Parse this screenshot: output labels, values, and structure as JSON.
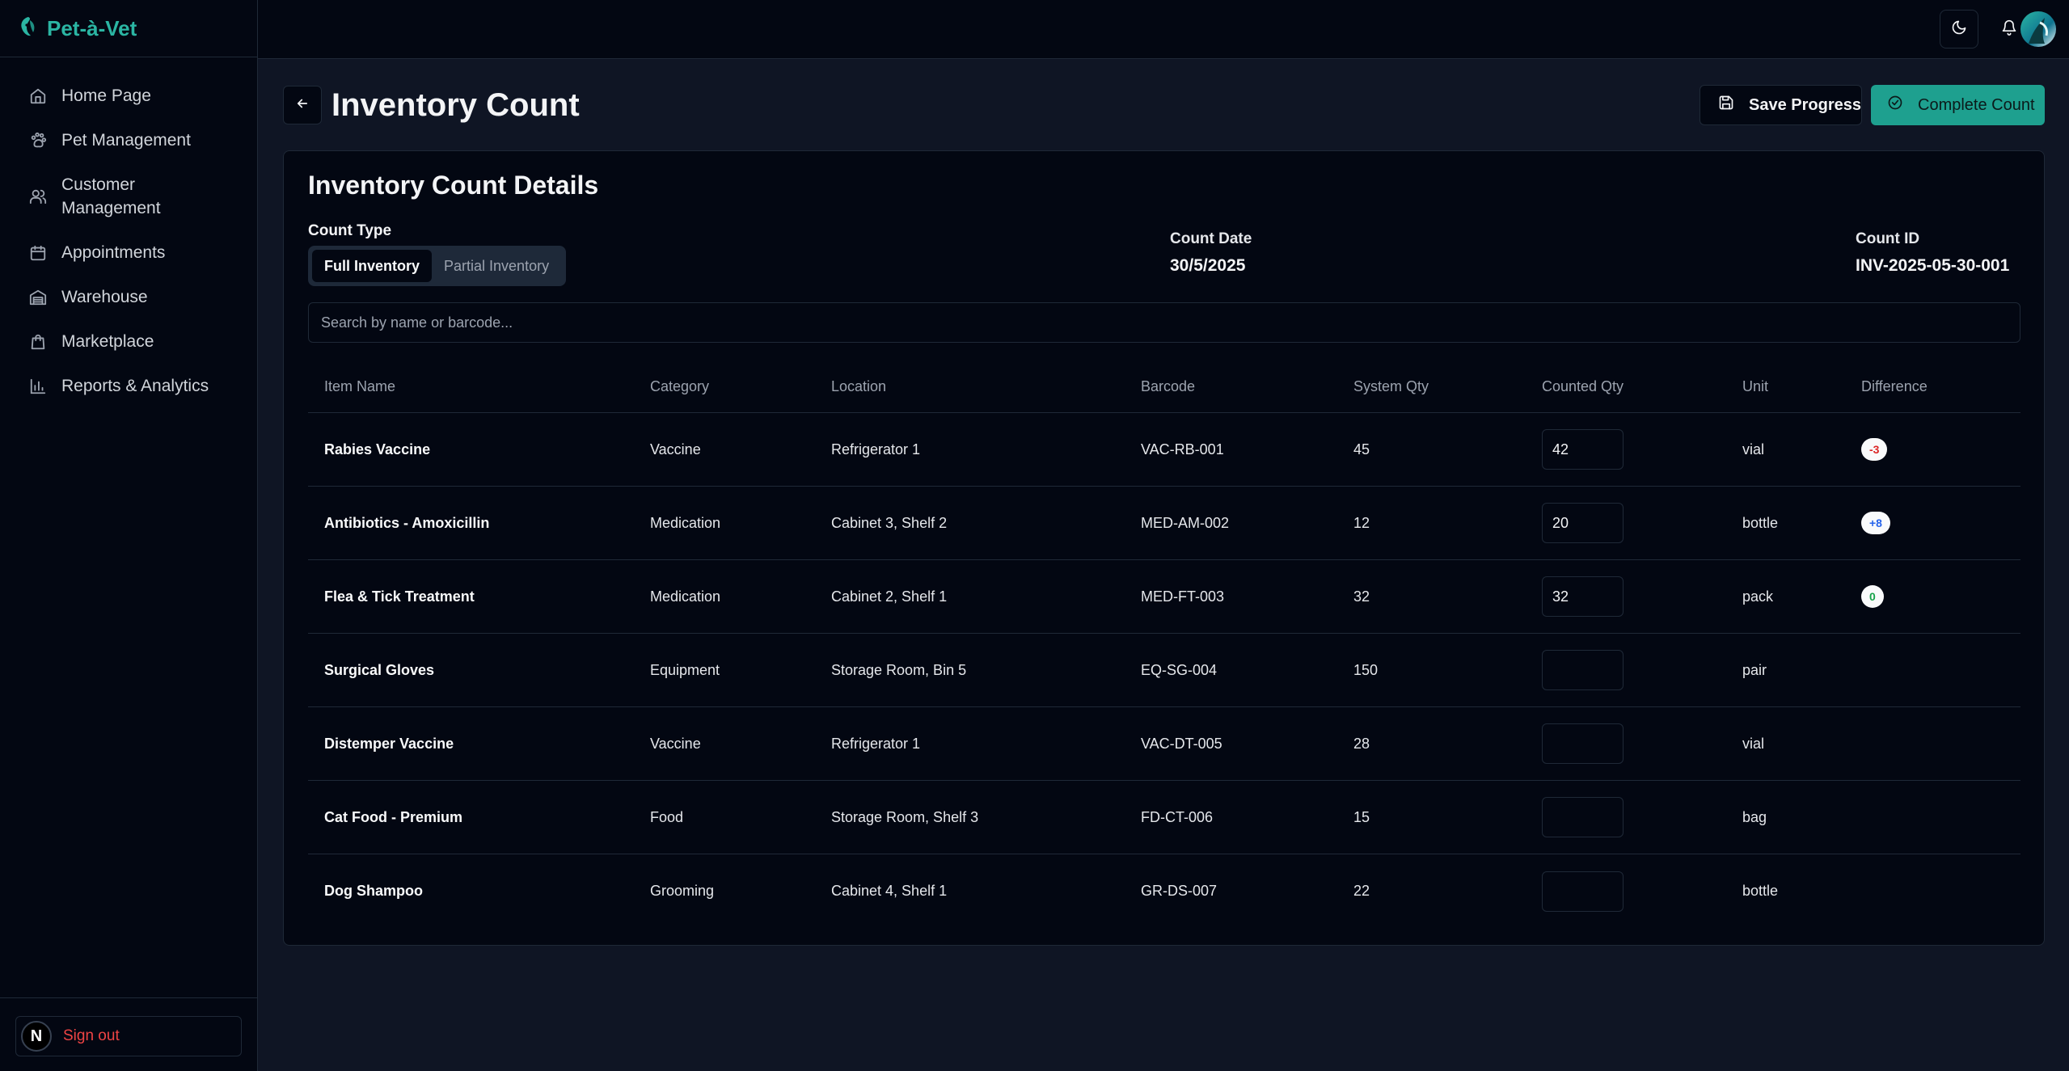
{
  "app": {
    "name": "Pet-à-Vet"
  },
  "sidebar": {
    "items": [
      {
        "label": "Home Page",
        "icon": "home-icon"
      },
      {
        "label": "Pet Management",
        "icon": "paw-icon"
      },
      {
        "label": "Customer Management",
        "icon": "users-icon"
      },
      {
        "label": "Appointments",
        "icon": "calendar-icon"
      },
      {
        "label": "Warehouse",
        "icon": "warehouse-icon"
      },
      {
        "label": "Marketplace",
        "icon": "shopping-bag-icon"
      },
      {
        "label": "Reports & Analytics",
        "icon": "bar-chart-icon"
      }
    ],
    "sign_out": "Sign out",
    "avatar_letter": "N"
  },
  "header": {
    "title": "Inventory Count",
    "save_label": "Save Progress",
    "complete_label": "Complete Count"
  },
  "details": {
    "title": "Inventory Count Details",
    "count_type_label": "Count Type",
    "count_types": [
      "Full Inventory",
      "Partial Inventory"
    ],
    "selected_count_type": "Full Inventory",
    "count_date_label": "Count Date",
    "count_date": "30/5/2025",
    "count_id_label": "Count ID",
    "count_id": "INV-2025-05-30-001",
    "search_placeholder": "Search by name or barcode..."
  },
  "table": {
    "columns": [
      "Item Name",
      "Category",
      "Location",
      "Barcode",
      "System Qty",
      "Counted Qty",
      "Unit",
      "Difference"
    ],
    "rows": [
      {
        "name": "Rabies Vaccine",
        "category": "Vaccine",
        "location": "Refrigerator 1",
        "barcode": "VAC-RB-001",
        "system_qty": "45",
        "counted_qty": "42",
        "unit": "vial",
        "difference": "-3"
      },
      {
        "name": "Antibiotics - Amoxicillin",
        "category": "Medication",
        "location": "Cabinet 3, Shelf 2",
        "barcode": "MED-AM-002",
        "system_qty": "12",
        "counted_qty": "20",
        "unit": "bottle",
        "difference": "+8"
      },
      {
        "name": "Flea & Tick Treatment",
        "category": "Medication",
        "location": "Cabinet 2, Shelf 1",
        "barcode": "MED-FT-003",
        "system_qty": "32",
        "counted_qty": "32",
        "unit": "pack",
        "difference": "0"
      },
      {
        "name": "Surgical Gloves",
        "category": "Equipment",
        "location": "Storage Room, Bin 5",
        "barcode": "EQ-SG-004",
        "system_qty": "150",
        "counted_qty": "",
        "unit": "pair",
        "difference": ""
      },
      {
        "name": "Distemper Vaccine",
        "category": "Vaccine",
        "location": "Refrigerator 1",
        "barcode": "VAC-DT-005",
        "system_qty": "28",
        "counted_qty": "",
        "unit": "vial",
        "difference": ""
      },
      {
        "name": "Cat Food - Premium",
        "category": "Food",
        "location": "Storage Room, Shelf 3",
        "barcode": "FD-CT-006",
        "system_qty": "15",
        "counted_qty": "",
        "unit": "bag",
        "difference": ""
      },
      {
        "name": "Dog Shampoo",
        "category": "Grooming",
        "location": "Cabinet 4, Shelf 1",
        "barcode": "GR-DS-007",
        "system_qty": "22",
        "counted_qty": "",
        "unit": "bottle",
        "difference": ""
      }
    ]
  },
  "colors": {
    "accent": "#2bb5a3",
    "negative": "#dc2626",
    "positive": "#2563eb",
    "neutral": "#16a34a",
    "sign_out": "#ef4444"
  }
}
